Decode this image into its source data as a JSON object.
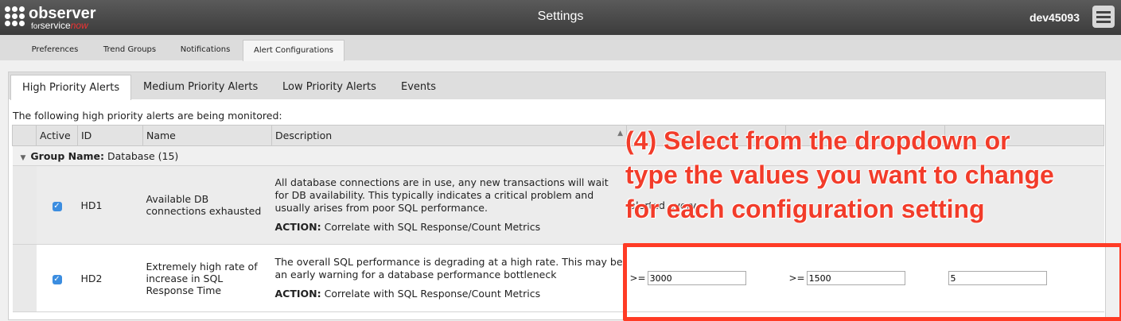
{
  "app": {
    "logo_main": "observer",
    "logo_for": "for",
    "logo_service": "service",
    "logo_now": "now",
    "title": "Settings",
    "user": "dev45093"
  },
  "top_tabs": [
    "Preferences",
    "Trend Groups",
    "Notifications",
    "Alert Configurations"
  ],
  "inner_tabs": [
    "High Priority Alerts",
    "Medium Priority Alerts",
    "Low Priority Alerts",
    "Events"
  ],
  "intro": "The following high priority alerts are being monitored:",
  "columns": {
    "active": "Active",
    "id": "ID",
    "name": "Name",
    "description": "Description"
  },
  "group": {
    "label": "Group Name:",
    "value": "Database (15)"
  },
  "rows": [
    {
      "active": true,
      "id": "HD1",
      "name": "Available DB connections exhausted",
      "description": "All database connections are in use, any new transactions will wait for DB availability. This typically indicates a critical problem and usually arises from poor SQL performance.",
      "action_label": "ACTION:",
      "action": "Correlate with SQL Response/Count Metrics",
      "threshold_text": "alerted every"
    },
    {
      "active": true,
      "id": "HD2",
      "name": "Extremely high rate of increase in SQL Response Time",
      "description": "The overall SQL performance is degrading at a high rate. This may be an early warning for a database performance bottleneck",
      "action_label": "ACTION:",
      "action": "Correlate with SQL Response/Count Metrics",
      "threshold_op": ">=",
      "threshold_1": "3000",
      "threshold_2": "1500",
      "threshold_3": "5"
    }
  ],
  "callout": {
    "line1": "(4) Select from the dropdown or",
    "line2": "type the values you want to change",
    "line3": "for each configuration setting"
  },
  "colors": {
    "callout": "#f23c2a",
    "checkbox": "#3b8de0",
    "topbar": "#4a4a4a"
  }
}
